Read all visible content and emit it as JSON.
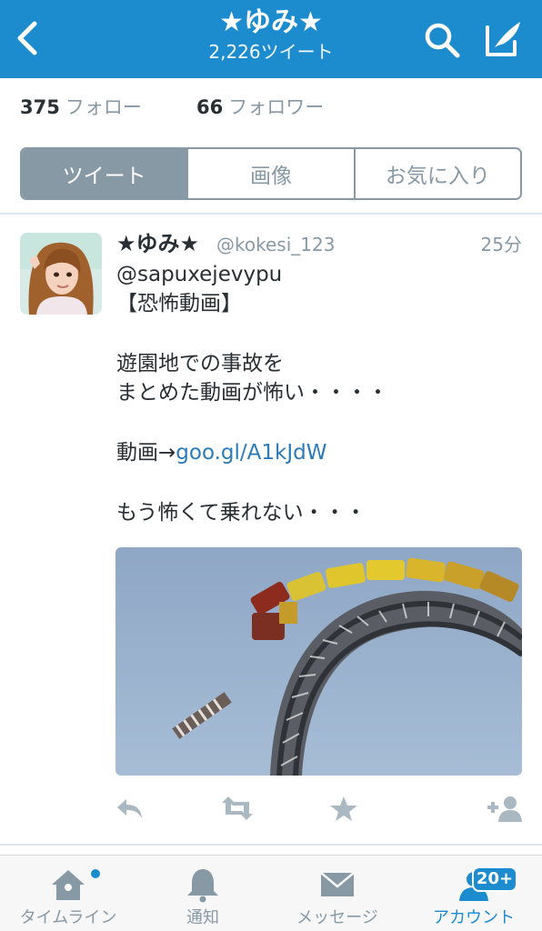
{
  "header": {
    "title": "★ゆみ★",
    "subtitle": "2,226ツイート"
  },
  "stats": {
    "following_count": "375",
    "following_label": "フォロー",
    "followers_count": "66",
    "followers_label": "フォロワー"
  },
  "tabs": [
    {
      "label": "ツイート",
      "active": true
    },
    {
      "label": "画像",
      "active": false
    },
    {
      "label": "お気に入り",
      "active": false
    }
  ],
  "tweet": {
    "name": "★ゆみ★",
    "handle": "@kokesi_123",
    "time": "25分",
    "lines": {
      "mention": "@sapuxejevypu",
      "tag": "【恐怖動画】",
      "l1": "遊園地での事故を",
      "l2": "まとめた動画が怖い・・・・",
      "link_prefix": "動画→",
      "link": "goo.gl/A1kJdW",
      "l3": "もう怖くて乗れない・・・"
    }
  },
  "tabbar": {
    "timeline": "タイムライン",
    "notifications": "通知",
    "messages": "メッセージ",
    "account": "アカウント",
    "badge": "20+"
  },
  "colors": {
    "brand": "#1c8ccf",
    "muted": "#8899a6",
    "link": "#2b7bb9"
  }
}
